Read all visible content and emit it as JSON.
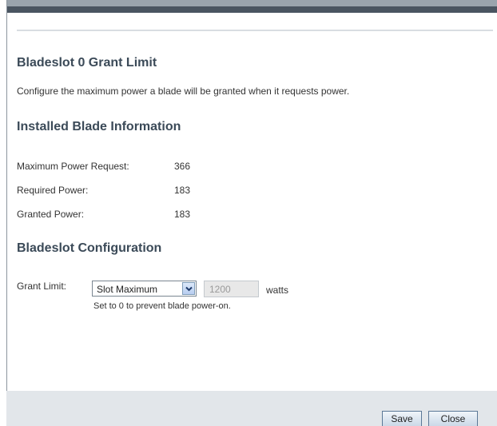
{
  "grant_limit_section": {
    "title": "Bladeslot 0 Grant Limit",
    "description": "Configure the maximum power a blade will be granted when it requests power."
  },
  "installed_blade": {
    "title": "Installed Blade Information",
    "rows": [
      {
        "label": "Maximum Power Request:",
        "value": "366"
      },
      {
        "label": "Required Power:",
        "value": "183"
      },
      {
        "label": "Granted Power:",
        "value": "183"
      }
    ]
  },
  "bladeslot_config": {
    "title": "Bladeslot Configuration",
    "grant_limit_label": "Grant Limit:",
    "grant_limit_select": {
      "selected": "Slot Maximum"
    },
    "grant_limit_input": {
      "value": "1200",
      "disabled": true
    },
    "unit": "watts",
    "hint": "Set to 0 to prevent blade power-on."
  },
  "footer": {
    "save_label": "Save",
    "close_label": "Close"
  },
  "colors": {
    "title_color": "#3b4a58",
    "header_band": "#4a5561",
    "footer_bg": "#e2e6ea"
  },
  "icons": {
    "select_arrow": "chevron-down-icon"
  }
}
